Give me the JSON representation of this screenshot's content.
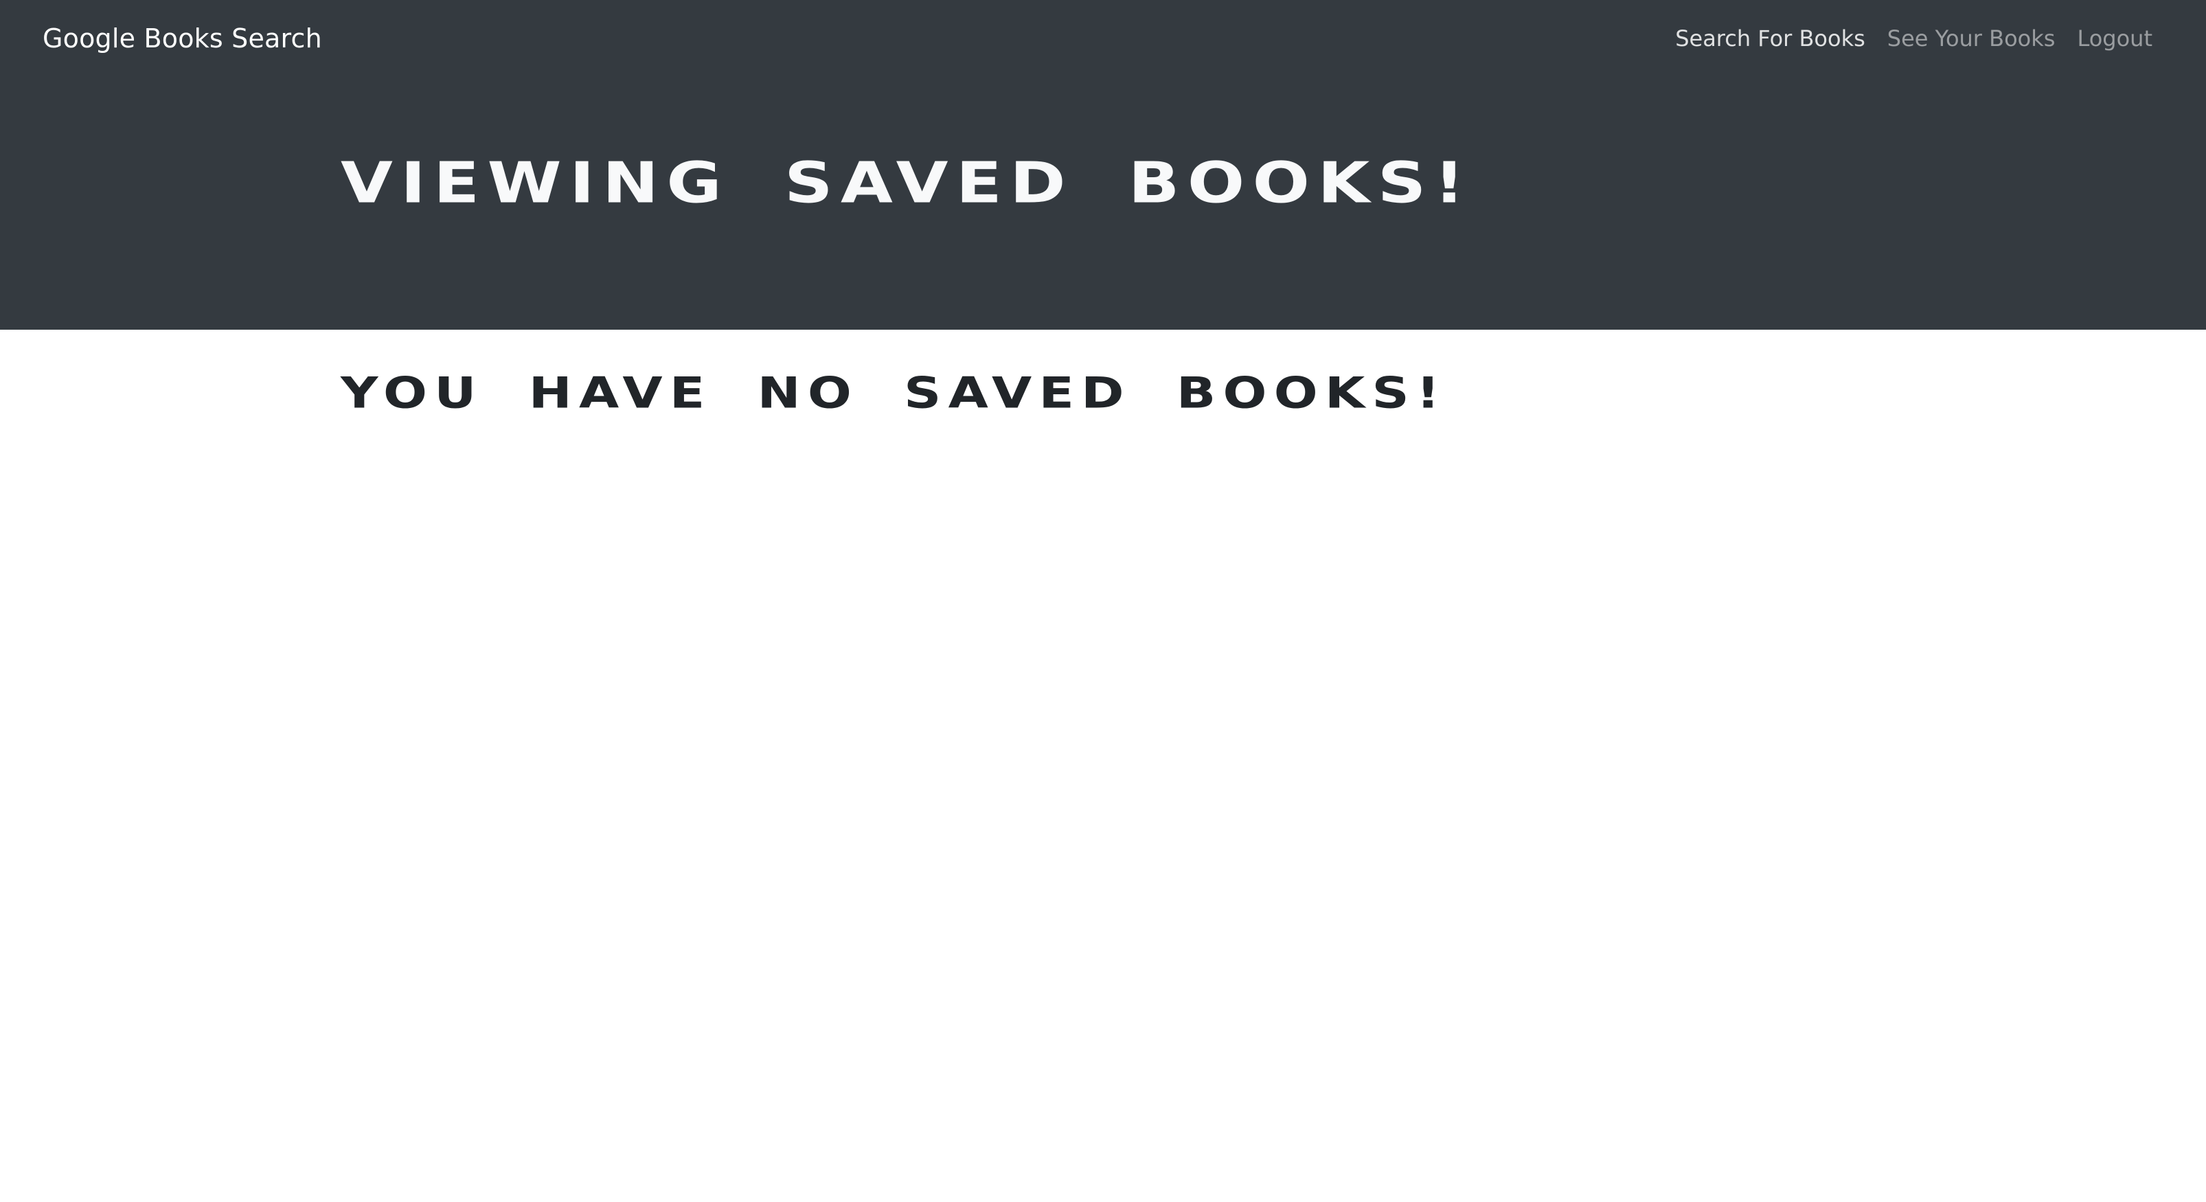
{
  "navbar": {
    "brand": "Google Books Search",
    "links": [
      {
        "label": "Search For Books",
        "active": true
      },
      {
        "label": "See Your Books",
        "active": false
      },
      {
        "label": "Logout",
        "active": false
      }
    ]
  },
  "hero": {
    "title": "Viewing saved books!"
  },
  "main": {
    "empty_message": "You have no saved books!"
  },
  "colors": {
    "header_background": "#343a40",
    "page_background": "#ffffff",
    "hero_text": "#f8f9fa",
    "body_text": "#212529"
  }
}
